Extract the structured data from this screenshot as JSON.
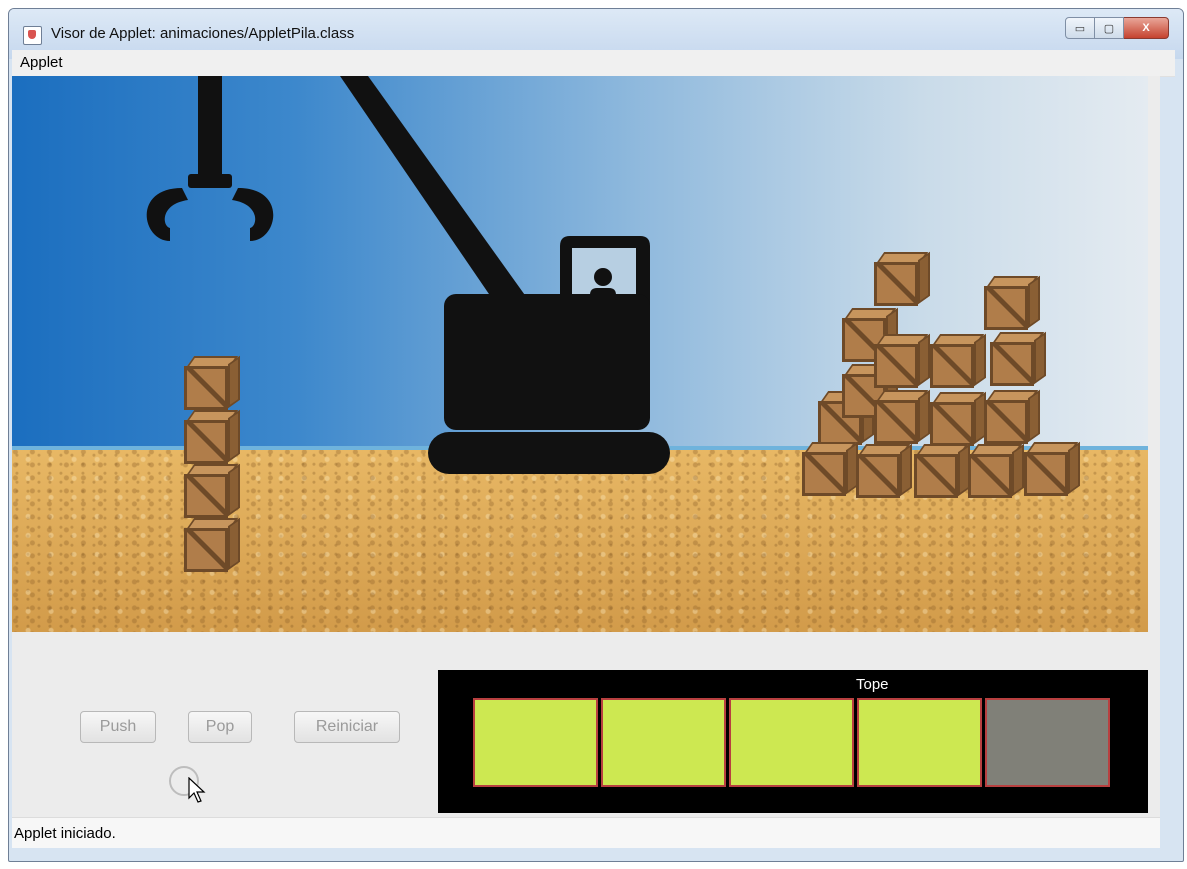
{
  "window": {
    "title": "Visor de Applet: animaciones/AppletPila.class",
    "minimize_glyph": "▭",
    "maximize_glyph": "▢",
    "close_glyph": "X"
  },
  "menu": {
    "items": [
      "Applet"
    ]
  },
  "scene": {
    "sky_gradient": [
      "#1b6ebf",
      "#e4ebf1"
    ],
    "ground_color": "#d9a455",
    "stacked_crates_count": 4
  },
  "controls": {
    "push_label": "Push",
    "pop_label": "Pop",
    "reset_label": "Reiniciar"
  },
  "stack": {
    "top_label": "Tope",
    "capacity": 5,
    "filled": 4,
    "slots": [
      {
        "state": "filled",
        "color": "#cde851"
      },
      {
        "state": "filled",
        "color": "#cde851"
      },
      {
        "state": "filled",
        "color": "#cde851"
      },
      {
        "state": "filled",
        "color": "#cde851"
      },
      {
        "state": "empty",
        "color": "#808078"
      }
    ]
  },
  "status": {
    "text": "Applet iniciado."
  }
}
